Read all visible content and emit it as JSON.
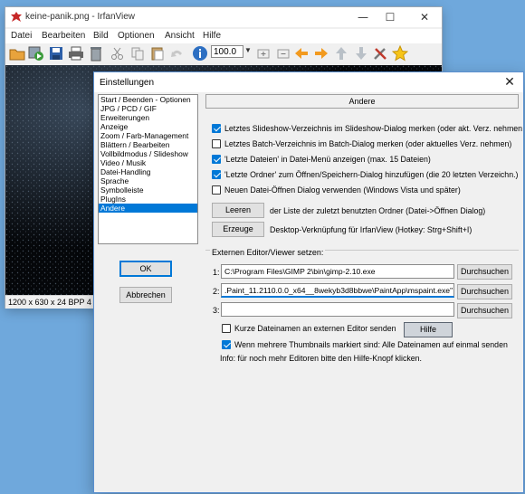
{
  "main_window": {
    "title": "keine-panik.png - IrfanView",
    "menu": [
      "Datei",
      "Bearbeiten",
      "Bild",
      "Optionen",
      "Ansicht",
      "Hilfe"
    ],
    "zoom": "100.0",
    "status": "1200 x 630 x 24 BPP   4"
  },
  "dialog": {
    "title": "Einstellungen",
    "categories": [
      "Start / Beenden - Optionen",
      "JPG / PCD / GIF",
      "Erweiterungen",
      "Anzeige",
      "Zoom / Farb-Management",
      "Blättern / Bearbeiten",
      "Vollbildmodus / Slideshow",
      "Video / Musik",
      "Datei-Handling",
      "Sprache",
      "Symbolleiste",
      "PlugIns",
      "Andere"
    ],
    "selected_category": "Andere",
    "ok_label": "OK",
    "cancel_label": "Abbrechen",
    "section_title": "Andere",
    "options": [
      {
        "label": "Letztes Slideshow-Verzeichnis im Slideshow-Dialog merken (oder akt. Verz. nehmen",
        "checked": true
      },
      {
        "label": "Letztes Batch-Verzeichnis im Batch-Dialog merken (oder aktuelles Verz. nehmen)",
        "checked": false
      },
      {
        "label": "'Letzte Dateien' in Datei-Menü anzeigen (max. 15 Dateien)",
        "checked": true
      },
      {
        "label": "'Letzte Ordner' zum Öffnen/Speichern-Dialog hinzufügen (die 20 letzten Verzeichn.)",
        "checked": true
      },
      {
        "label": "Neuen Datei-Öffnen Dialog verwenden (Windows Vista und später)",
        "checked": false
      }
    ],
    "clear_button": "Leeren",
    "clear_text": "der Liste der zuletzt benutzten Ordner (Datei->Öffnen Dialog)",
    "create_button": "Erzeuge",
    "create_text": "Desktop-Verknüpfung für IrfanView (Hotkey: Strg+Shift+I)",
    "editors_group_label": "Externen Editor/Viewer setzen:",
    "editors": [
      {
        "number": "1:",
        "value": "C:\\Program Files\\GIMP 2\\bin\\gimp-2.10.exe",
        "browse": "Durchsuchen"
      },
      {
        "number": "2:",
        "value": ".Paint_11.2110.0.0_x64__8wekyb3d8bbwe\\PaintApp\\mspaint.exe\"",
        "browse": "Durchsuchen"
      },
      {
        "number": "3:",
        "value": "",
        "browse": "Durchsuchen"
      }
    ],
    "short_names_label": "Kurze Dateinamen an externen Editor senden",
    "short_names_checked": false,
    "help_button": "Hilfe",
    "thumbnails_label": "Wenn mehrere Thumbnails markiert sind: Alle Dateinamen auf einmal senden",
    "thumbnails_checked": true,
    "info_text": "Info: für noch mehr Editoren bitte den Hilfe-Knopf klicken."
  },
  "colors": {
    "accent": "#0078d7",
    "desktop": "#6fa8dc",
    "dialog_bg": "#f0f0f0"
  }
}
